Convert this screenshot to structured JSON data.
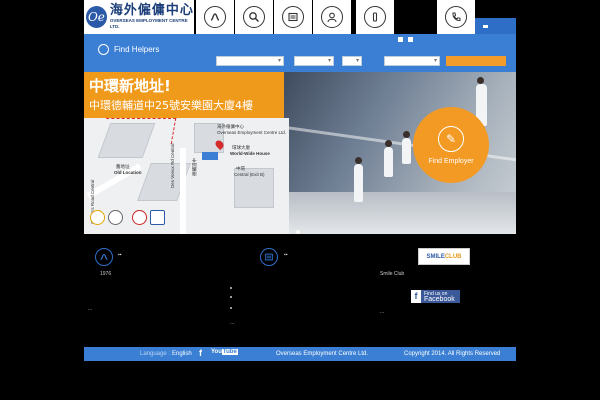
{
  "logo": {
    "chinese_name": "海外僱傭中心",
    "english_name": "OVERSEAS EMPLOYMENT CENTRE LTD."
  },
  "top_nav": {
    "icons": [
      "about-icon",
      "search-icon",
      "list-icon",
      "user-icon",
      "info-icon",
      "phone-icon"
    ]
  },
  "search": {
    "label": "Find Helpers"
  },
  "banner": {
    "headline": "中環新地址!",
    "address": "中環德輔道中25號安樂園大廈4樓",
    "find_employer_label": "Find Employer",
    "map": {
      "company_cn": "海外僱傭中心",
      "company_en": "Overseas Employment Centre Ltd.",
      "building_cn": "環球大廈",
      "building_en": "World-Wide House",
      "old_cn": "舊地址",
      "old_en": "Old Location",
      "road1": "Des Voeux Rd Central",
      "road1_cn": "德輔道中",
      "road2": "Queen's Road Central",
      "station_cn": "中環",
      "station_en": "Central (Exit B)"
    }
  },
  "info": {
    "col1_year": "1976",
    "col3_label": "Smile Club",
    "smile_club_text": "SMILE",
    "smile_club_text2": "CLUB",
    "facebook_line1": "Find us on",
    "facebook_line2": "Facebook",
    "ellipsis": "..."
  },
  "footer": {
    "language_label": "Language :",
    "language_value": "English",
    "youtube_you": "You",
    "youtube_tube": "Tube",
    "company": "Overseas Employment Centre Ltd.",
    "copyright": "Copyright 2014. All Rights Reserved"
  },
  "colors": {
    "primary_blue": "#3a7fd3",
    "accent_orange": "#f39a24"
  }
}
